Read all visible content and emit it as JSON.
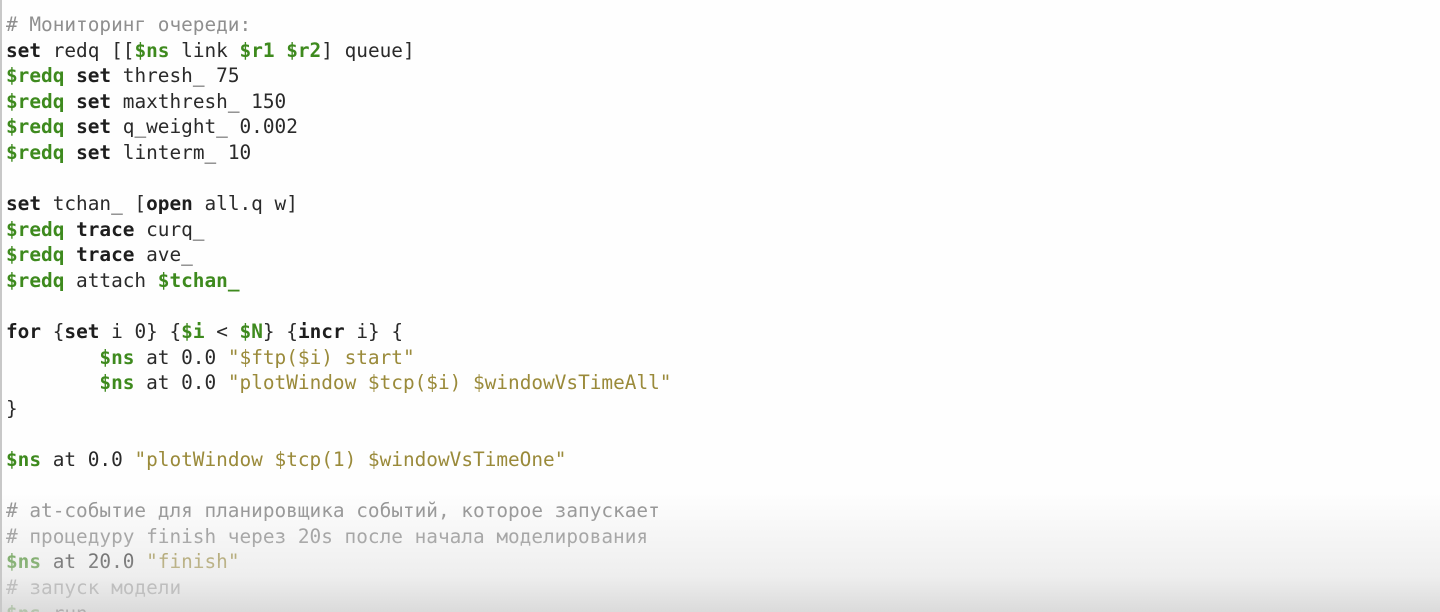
{
  "editor": {
    "lines": [
      [
        {
          "t": "cmt",
          "v": "# Мониторинг очереди:"
        }
      ],
      [
        {
          "t": "kw",
          "v": "set"
        },
        {
          "t": "plain",
          "v": " redq [["
        },
        {
          "t": "var",
          "v": "$ns"
        },
        {
          "t": "plain",
          "v": " link "
        },
        {
          "t": "var",
          "v": "$r1 $r2"
        },
        {
          "t": "plain",
          "v": "] queue]"
        }
      ],
      [
        {
          "t": "var",
          "v": "$redq"
        },
        {
          "t": "plain",
          "v": " "
        },
        {
          "t": "kw",
          "v": "set"
        },
        {
          "t": "plain",
          "v": " thresh_ 75"
        }
      ],
      [
        {
          "t": "var",
          "v": "$redq"
        },
        {
          "t": "plain",
          "v": " "
        },
        {
          "t": "kw",
          "v": "set"
        },
        {
          "t": "plain",
          "v": " maxthresh_ 150"
        }
      ],
      [
        {
          "t": "var",
          "v": "$redq"
        },
        {
          "t": "plain",
          "v": " "
        },
        {
          "t": "kw",
          "v": "set"
        },
        {
          "t": "plain",
          "v": " q_weight_ 0.002"
        }
      ],
      [
        {
          "t": "var",
          "v": "$redq"
        },
        {
          "t": "plain",
          "v": " "
        },
        {
          "t": "kw",
          "v": "set"
        },
        {
          "t": "plain",
          "v": " linterm_ 10"
        }
      ],
      [],
      [
        {
          "t": "kw",
          "v": "set"
        },
        {
          "t": "plain",
          "v": " tchan_ ["
        },
        {
          "t": "kw",
          "v": "open"
        },
        {
          "t": "plain",
          "v": " all.q w]"
        }
      ],
      [
        {
          "t": "var",
          "v": "$redq"
        },
        {
          "t": "plain",
          "v": " "
        },
        {
          "t": "kw",
          "v": "trace"
        },
        {
          "t": "plain",
          "v": " curq_"
        }
      ],
      [
        {
          "t": "var",
          "v": "$redq"
        },
        {
          "t": "plain",
          "v": " "
        },
        {
          "t": "kw",
          "v": "trace"
        },
        {
          "t": "plain",
          "v": " ave_"
        }
      ],
      [
        {
          "t": "var",
          "v": "$redq"
        },
        {
          "t": "plain",
          "v": " attach "
        },
        {
          "t": "var",
          "v": "$tchan_"
        }
      ],
      [],
      [
        {
          "t": "kw",
          "v": "for"
        },
        {
          "t": "plain",
          "v": " {"
        },
        {
          "t": "kw",
          "v": "set"
        },
        {
          "t": "plain",
          "v": " i 0} {"
        },
        {
          "t": "var",
          "v": "$i"
        },
        {
          "t": "plain",
          "v": " < "
        },
        {
          "t": "var",
          "v": "$N"
        },
        {
          "t": "plain",
          "v": "} {"
        },
        {
          "t": "kw",
          "v": "incr"
        },
        {
          "t": "plain",
          "v": " i} {"
        }
      ],
      [
        {
          "t": "plain",
          "v": "        "
        },
        {
          "t": "var",
          "v": "$ns"
        },
        {
          "t": "plain",
          "v": " at 0.0 "
        },
        {
          "t": "str",
          "v": "\"$ftp($i) start\""
        }
      ],
      [
        {
          "t": "plain",
          "v": "        "
        },
        {
          "t": "var",
          "v": "$ns"
        },
        {
          "t": "plain",
          "v": " at 0.0 "
        },
        {
          "t": "str",
          "v": "\"plotWindow $tcp($i) $windowVsTimeAll\""
        }
      ],
      [
        {
          "t": "plain",
          "v": "}"
        }
      ],
      [],
      [
        {
          "t": "var",
          "v": "$ns"
        },
        {
          "t": "plain",
          "v": " at 0.0 "
        },
        {
          "t": "str",
          "v": "\"plotWindow $tcp(1) $windowVsTimeOne\""
        }
      ],
      [],
      [
        {
          "t": "cmt",
          "v": "# at-событие для планировщика событий, которое запускает"
        }
      ],
      [
        {
          "t": "cmt",
          "v": "# процедуру finish через 20s после начала моделирования"
        }
      ],
      [
        {
          "t": "var",
          "v": "$ns"
        },
        {
          "t": "plain",
          "v": " at 20.0 "
        },
        {
          "t": "str",
          "v": "\"finish\""
        }
      ],
      [
        {
          "t": "cmt",
          "v": "# запуск модели"
        }
      ],
      [
        {
          "t": "var",
          "v": "$ns"
        },
        {
          "t": "plain",
          "v": " run"
        }
      ]
    ]
  }
}
